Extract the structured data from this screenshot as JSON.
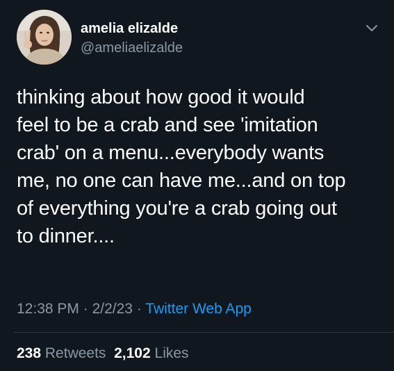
{
  "user": {
    "display_name": "amelia elizalde",
    "handle": "@ameliaelizalde"
  },
  "tweet": {
    "lines": [
      "thinking about how good it would",
      "feel to be a crab and see 'imitation",
      "crab' on a menu...everybody wants",
      "me, no one can have me...and on top",
      "of everything you're a crab going out",
      "to dinner...."
    ],
    "time": "12:38 PM",
    "separator": "·",
    "date": "2/2/23",
    "source": "Twitter Web App"
  },
  "stats": {
    "retweets_count": "238",
    "retweets_label": "Retweets",
    "likes_count": "2,102",
    "likes_label": "Likes"
  },
  "icons": {
    "menu": "chevron-down-icon"
  },
  "colors": {
    "background": "#10171e",
    "text": "#ffffff",
    "muted": "#8b98a5",
    "accent": "#1d9bf0"
  }
}
